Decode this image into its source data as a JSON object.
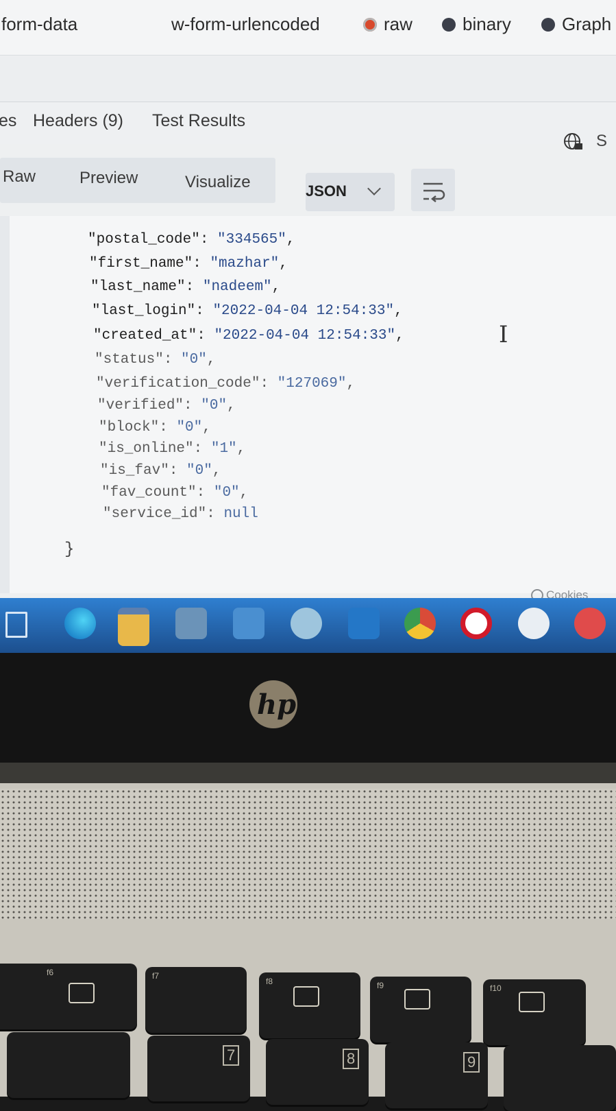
{
  "body_types": {
    "form_data": "form-data",
    "urlencoded": "w-form-urlencoded",
    "raw": "raw",
    "binary": "binary",
    "graphql": "Graph"
  },
  "response_tabs": {
    "partial": "es",
    "headers": "Headers (9)",
    "test_results": "Test Results",
    "save_partial": "S"
  },
  "view_modes": {
    "raw": "Raw",
    "preview": "Preview",
    "visualize": "Visualize",
    "format": "JSON"
  },
  "json_lines": [
    {
      "key": "\"postal_code\"",
      "value": "\"334565\"",
      "tail": ","
    },
    {
      "key": "\"first_name\"",
      "value": "\"mazhar\"",
      "tail": ","
    },
    {
      "key": "\"last_name\"",
      "value": "\"nadeem\"",
      "tail": ","
    },
    {
      "key": "\"last_login\"",
      "value": "\"2022-04-04 12:54:33\"",
      "tail": ","
    },
    {
      "key": "\"created_at\"",
      "value": "\"2022-04-04 12:54:33\"",
      "tail": ","
    },
    {
      "key": "\"status\"",
      "value": "\"0\"",
      "tail": ","
    },
    {
      "key": "\"verification_code\"",
      "value": "\"127069\"",
      "tail": ","
    },
    {
      "key": "\"verified\"",
      "value": "\"0\"",
      "tail": ","
    },
    {
      "key": "\"block\"",
      "value": "\"0\"",
      "tail": ","
    },
    {
      "key": "\"is_online\"",
      "value": "\"1\"",
      "tail": ","
    },
    {
      "key": "\"is_fav\"",
      "value": "\"0\"",
      "tail": ","
    },
    {
      "key": "\"fav_count\"",
      "value": "\"0\"",
      "tail": ","
    },
    {
      "key": "\"service_id\"",
      "value": "null",
      "tail": ""
    }
  ],
  "closing_brace": "}",
  "cookies": "Cookies",
  "taskbar_icons": [
    "task-view-icon",
    "edge-icon",
    "file-explorer-icon",
    "store-icon",
    "mail-icon",
    "postman-icon",
    "vscode-icon",
    "chrome-icon",
    "opera-icon",
    "app-icon",
    "pen-app-icon"
  ],
  "keys": {
    "f6": "f6",
    "f7": "f7",
    "f8": "f8",
    "f9": "f9",
    "f10": "f10",
    "seven": "7",
    "eight": "8",
    "nine": "9"
  },
  "colors": {
    "raw_radio": "#d8492c",
    "taskbar": "#2f7fd0",
    "json_value": "#2a4a8a"
  },
  "brand": "hp"
}
